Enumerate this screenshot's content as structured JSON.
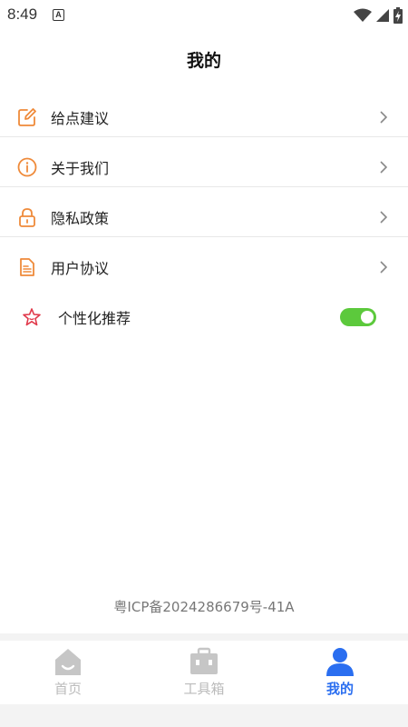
{
  "status_bar": {
    "time": "8:49",
    "a_badge": "A"
  },
  "header": {
    "title": "我的"
  },
  "menu": [
    {
      "label": "给点建议",
      "icon": "edit-icon"
    },
    {
      "label": "关于我们",
      "icon": "info-icon"
    },
    {
      "label": "隐私政策",
      "icon": "lock-icon"
    },
    {
      "label": "用户协议",
      "icon": "document-icon"
    }
  ],
  "personalized": {
    "label": "个性化推荐",
    "icon": "star-icon",
    "enabled": true
  },
  "footer": {
    "icp": "粤ICP备2024286679号-41A"
  },
  "tabs": [
    {
      "label": "首页",
      "icon": "home-icon",
      "active": false
    },
    {
      "label": "工具箱",
      "icon": "toolbox-icon",
      "active": false
    },
    {
      "label": "我的",
      "icon": "profile-icon",
      "active": true
    }
  ],
  "colors": {
    "accent_orange": "#ef8a3a",
    "toggle_green": "#5cc93c",
    "active_blue": "#2a6ef0",
    "star_red": "#e0384a"
  }
}
